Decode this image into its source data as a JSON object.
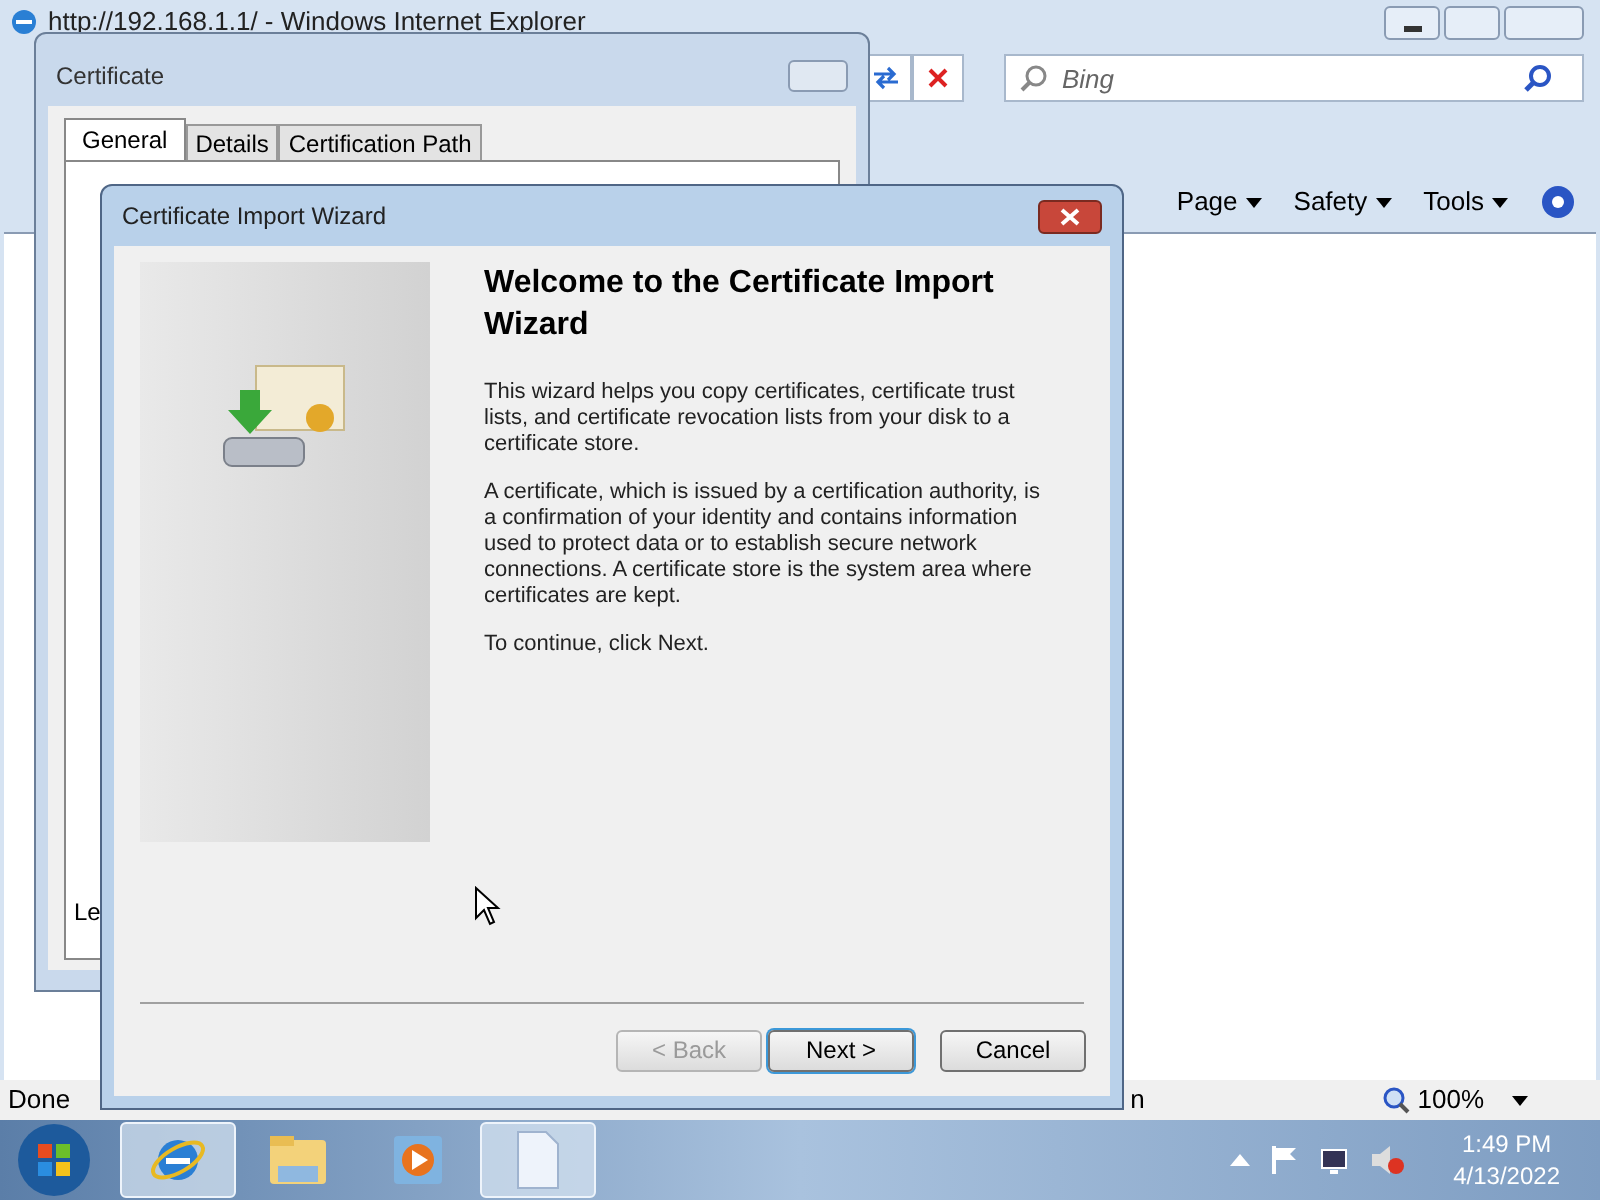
{
  "browser": {
    "title": "http://192.168.1.1/ - Windows Internet Explorer",
    "search": {
      "placeholder": "Bing"
    },
    "commands": [
      "Page",
      "Safety",
      "Tools"
    ],
    "status": "Done",
    "status_fragment": "n",
    "zoom": "100%"
  },
  "certificate_dialog": {
    "title": "Certificate",
    "tabs": [
      {
        "label": "General",
        "selected": true
      },
      {
        "label": "Details",
        "selected": false
      },
      {
        "label": "Certification Path",
        "selected": false
      }
    ],
    "partial_text": "Le"
  },
  "wizard": {
    "title": "Certificate Import Wizard",
    "heading": "Welcome to the Certificate Import Wizard",
    "paragraphs": [
      "This wizard helps you copy certificates, certificate trust lists, and certificate revocation lists from your disk to a certificate store.",
      "A certificate, which is issued by a certification authority, is a confirmation of your identity and contains information used to protect data or to establish secure network connections. A certificate store is the system area where certificates are kept.",
      "To continue, click Next."
    ],
    "buttons": [
      {
        "label": "< Back",
        "disabled": true,
        "default": false
      },
      {
        "label": "Next >",
        "disabled": false,
        "default": true
      },
      {
        "label": "Cancel",
        "disabled": false,
        "default": false
      }
    ]
  },
  "taskbar": {
    "items": [
      {
        "kind": "ie",
        "selected": true
      },
      {
        "kind": "folder",
        "selected": false
      },
      {
        "kind": "media",
        "selected": false
      },
      {
        "kind": "document",
        "selected": true
      }
    ],
    "time": "1:49 PM",
    "date": "4/13/2022"
  }
}
